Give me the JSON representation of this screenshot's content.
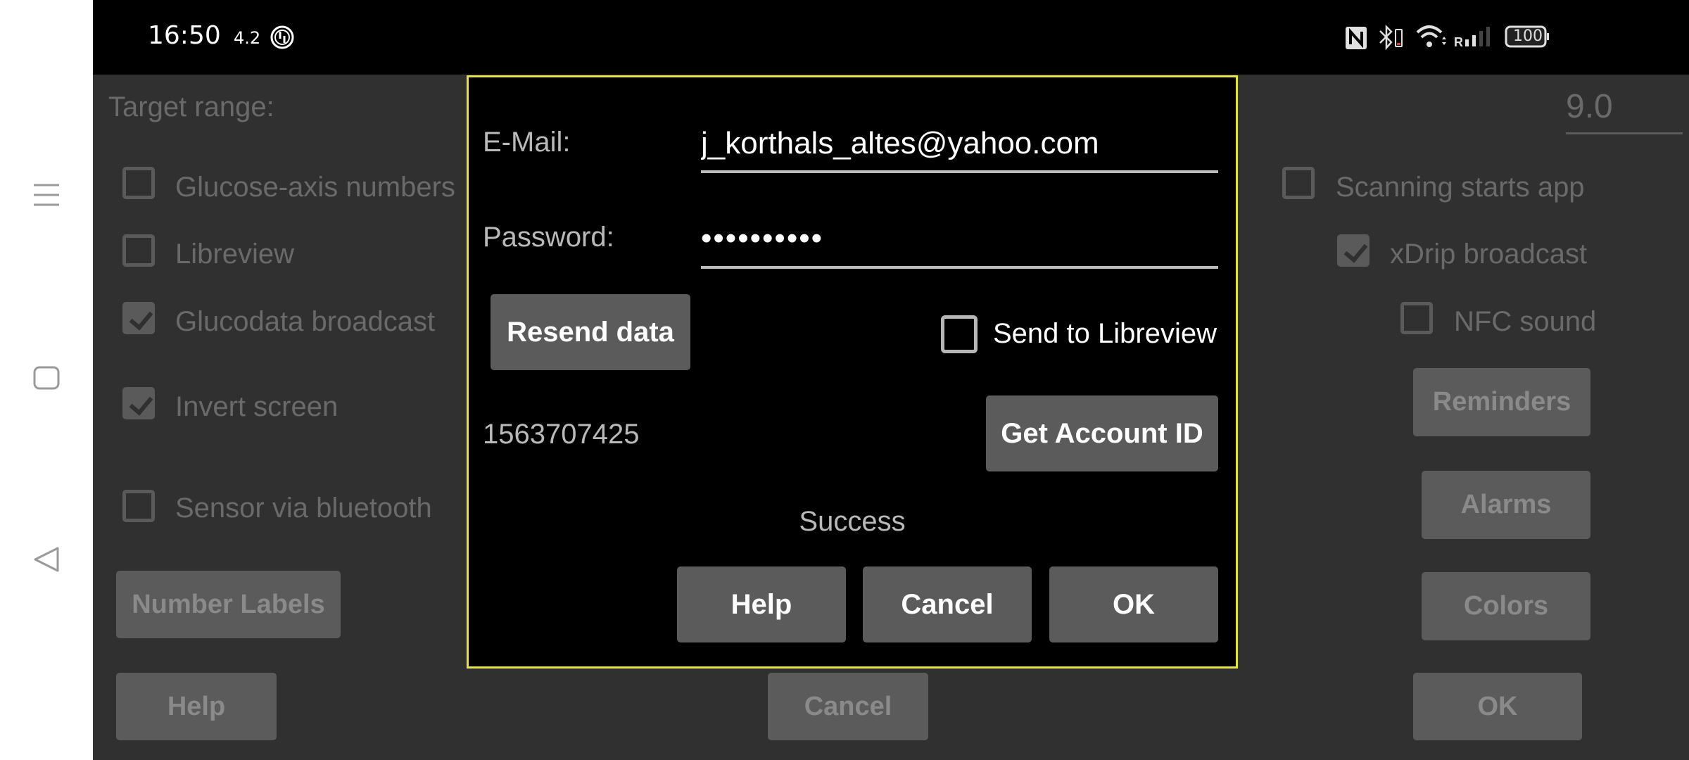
{
  "status_bar": {
    "time": "16:50",
    "network_speed": "4.2",
    "battery_level": "100",
    "icons": [
      "sync-icon",
      "nfc-icon",
      "bluetooth-icon",
      "wifi-icon",
      "signal-icon",
      "battery-icon"
    ],
    "roaming_label": "R"
  },
  "nav_bar": {
    "icons": [
      "menu-icon",
      "home-icon",
      "back-icon"
    ]
  },
  "settings": {
    "target_range_label": "Target range:",
    "target_range_high": "9.0",
    "checkboxes_left": [
      {
        "label": "Glucose-axis numbers",
        "checked": false
      },
      {
        "label": "Libreview",
        "checked": false
      },
      {
        "label": "Glucodata broadcast",
        "checked": true
      },
      {
        "label": "Invert screen",
        "checked": true
      },
      {
        "label": "Sensor via bluetooth",
        "checked": false
      }
    ],
    "checkboxes_right": [
      {
        "label": "Scanning starts app",
        "checked": false
      },
      {
        "label": "xDrip broadcast",
        "checked": true
      },
      {
        "label": "NFC sound",
        "checked": false
      }
    ],
    "buttons": {
      "number_labels": "Number Labels",
      "help": "Help",
      "cancel": "Cancel",
      "ok": "OK",
      "reminders": "Reminders",
      "alarms": "Alarms",
      "colors": "Colors"
    }
  },
  "dialog": {
    "email_label": "E-Mail:",
    "email_value": "j_korthals_altes@yahoo.com",
    "password_label": "Password:",
    "password_value": "••••••••••",
    "resend_button": "Resend data",
    "send_to_libreview_label": "Send to Libreview",
    "send_to_libreview_checked": false,
    "account_id": "1563707425",
    "get_account_id_button": "Get Account ID",
    "status_message": "Success",
    "help_button": "Help",
    "cancel_button": "Cancel",
    "ok_button": "OK",
    "border_color": "#e6e14a"
  }
}
